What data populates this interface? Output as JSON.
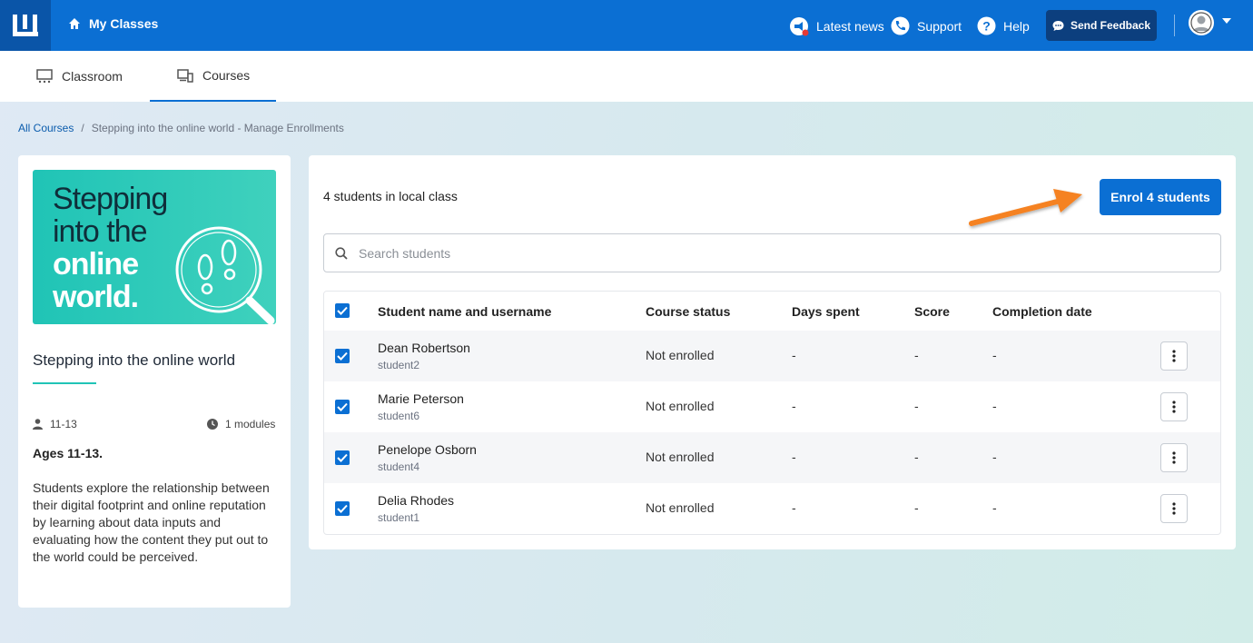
{
  "header": {
    "home_label": "My Classes",
    "latest_news": "Latest news",
    "support": "Support",
    "help": "Help",
    "send_feedback": "Send Feedback",
    "brand_color": "#0b6fd3"
  },
  "tabs": [
    {
      "label": "Classroom",
      "icon": "classroom-icon",
      "active": false
    },
    {
      "label": "Courses",
      "icon": "courses-icon",
      "active": true
    }
  ],
  "breadcrumb": {
    "root": "All Courses",
    "separator": "/",
    "current": "Stepping into the online world - Manage Enrollments"
  },
  "course": {
    "image_text": [
      "Stepping",
      "into the",
      "online",
      "world."
    ],
    "title": "Stepping into the online world",
    "age_range": "11-13",
    "modules": "1 modules",
    "ages_heading": "Ages 11-13.",
    "description": "Students explore the relationship between their digital footprint and online reputation by learning about data inputs and evaluating how the content they put out to the world could be perceived."
  },
  "enrol": {
    "count_label": "4 students in local class",
    "button_label": "Enrol 4 students",
    "search_placeholder": "Search students"
  },
  "table": {
    "columns": [
      "Student name and username",
      "Course status",
      "Days spent",
      "Score",
      "Completion date"
    ],
    "rows": [
      {
        "name": "Dean Robertson",
        "username": "student2",
        "status": "Not enrolled",
        "days": "-",
        "score": "-",
        "completion": "-",
        "checked": true
      },
      {
        "name": "Marie Peterson",
        "username": "student6",
        "status": "Not enrolled",
        "days": "-",
        "score": "-",
        "completion": "-",
        "checked": true
      },
      {
        "name": "Penelope Osborn",
        "username": "student4",
        "status": "Not enrolled",
        "days": "-",
        "score": "-",
        "completion": "-",
        "checked": true
      },
      {
        "name": "Delia Rhodes",
        "username": "student1",
        "status": "Not enrolled",
        "days": "-",
        "score": "-",
        "completion": "-",
        "checked": true
      }
    ]
  }
}
